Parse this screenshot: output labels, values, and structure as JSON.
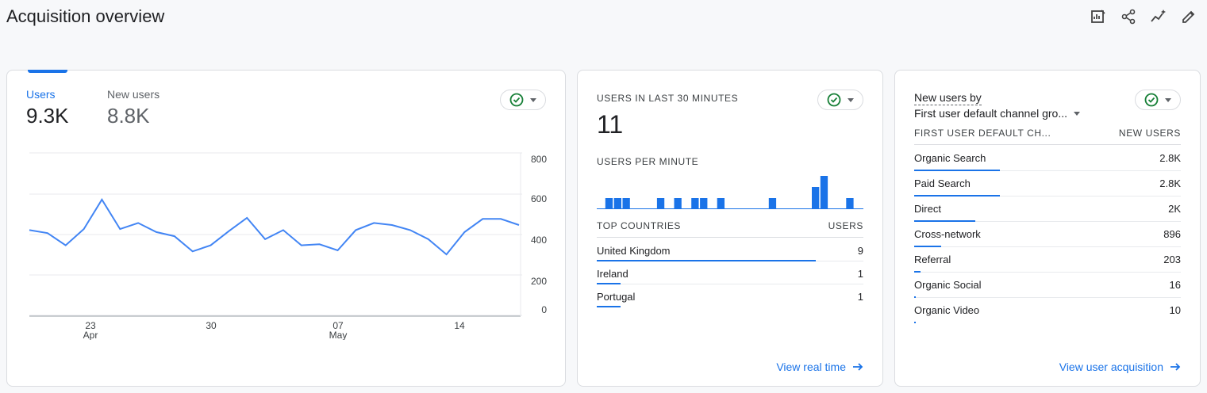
{
  "page": {
    "title": "Acquisition overview",
    "icons": [
      "chart-customize-icon",
      "share-icon",
      "insights-icon",
      "edit-icon"
    ]
  },
  "users_card": {
    "metrics": [
      {
        "label": "Users",
        "value": "9.3K"
      },
      {
        "label": "New users",
        "value": "8.8K"
      }
    ],
    "y_ticks": [
      "800",
      "600",
      "400",
      "200",
      "0"
    ],
    "x_ticks": [
      {
        "day": "23",
        "month": "Apr"
      },
      {
        "day": "30",
        "month": ""
      },
      {
        "day": "07",
        "month": "May"
      },
      {
        "day": "14",
        "month": ""
      }
    ]
  },
  "realtime_card": {
    "title": "USERS IN LAST 30 MINUTES",
    "value": "11",
    "per_minute_label": "USERS PER MINUTE",
    "countries_header": "TOP COUNTRIES",
    "users_header": "USERS",
    "countries": [
      {
        "name": "United Kingdom",
        "value": "9",
        "share": 0.82
      },
      {
        "name": "Ireland",
        "value": "1",
        "share": 0.09
      },
      {
        "name": "Portugal",
        "value": "1",
        "share": 0.09
      }
    ],
    "link": "View real time"
  },
  "acq_card": {
    "title_prefix": "New users by",
    "dimension": "First user default channel gro...",
    "col_dim": "FIRST USER DEFAULT CH...",
    "col_metric": "NEW USERS",
    "rows": [
      {
        "name": "Organic Search",
        "value": "2.8K",
        "share": 0.32
      },
      {
        "name": "Paid Search",
        "value": "2.8K",
        "share": 0.32
      },
      {
        "name": "Direct",
        "value": "2K",
        "share": 0.23
      },
      {
        "name": "Cross-network",
        "value": "896",
        "share": 0.1
      },
      {
        "name": "Referral",
        "value": "203",
        "share": 0.023
      },
      {
        "name": "Organic Social",
        "value": "16",
        "share": 0.002
      },
      {
        "name": "Organic Video",
        "value": "10",
        "share": 0.001
      }
    ],
    "link": "View user acquisition"
  },
  "chart_data": [
    {
      "type": "line",
      "series": [
        {
          "values": [
            420,
            405,
            345,
            425,
            570,
            425,
            455,
            410,
            390,
            315,
            345,
            415,
            480,
            375,
            420,
            345,
            350,
            320,
            420,
            455,
            445,
            420,
            375,
            300,
            410,
            475,
            475,
            445
          ]
        }
      ],
      "ylim": [
        0,
        800
      ],
      "y_ticks": [
        0,
        200,
        400,
        600,
        800
      ],
      "x_tick_labels": [
        "23 Apr",
        "30",
        "07 May",
        "14"
      ],
      "grid": true
    },
    {
      "type": "bar",
      "values": [
        0,
        1,
        1,
        1,
        0,
        0,
        0,
        1,
        0,
        1,
        0,
        1,
        1,
        0,
        1,
        0,
        0,
        0,
        0,
        0,
        1,
        0,
        0,
        0,
        0,
        2,
        3,
        0,
        0,
        1,
        0
      ],
      "ylim": [
        0,
        3
      ]
    }
  ]
}
